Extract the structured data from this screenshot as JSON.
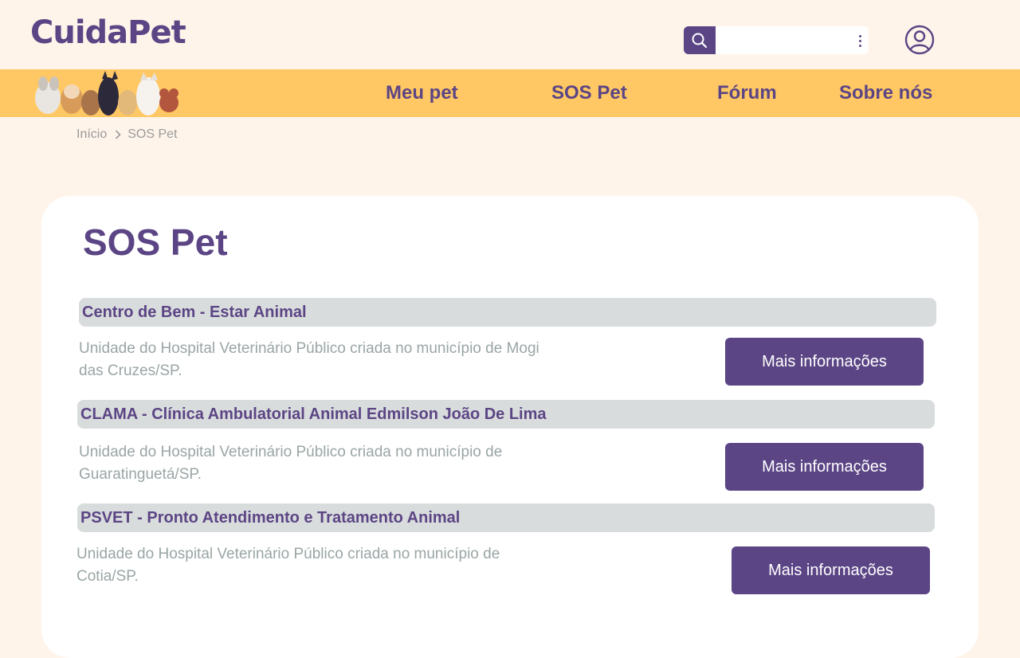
{
  "header": {
    "logo_text": "CuidaPet",
    "search": {
      "placeholder": "",
      "value": ""
    }
  },
  "nav": {
    "items": [
      {
        "label": "Meu pet"
      },
      {
        "label": "SOS Pet"
      },
      {
        "label": "Fórum"
      },
      {
        "label": "Sobre nós"
      }
    ]
  },
  "breadcrumb": {
    "items": [
      {
        "label": "Início"
      },
      {
        "label": "SOS Pet"
      }
    ]
  },
  "main": {
    "title": "SOS Pet",
    "entries": [
      {
        "name": "Centro de Bem - Estar Animal",
        "description": "Unidade do Hospital Veterinário Público criada no município de Mogi das Cruzes/SP.",
        "button_label": "Mais informações"
      },
      {
        "name": "CLAMA - Clínica Ambulatorial Animal Edmilson João De Lima",
        "description": "Unidade do Hospital Veterinário Público criada no município de Guaratinguetá/SP.",
        "button_label": "Mais informações"
      },
      {
        "name": "PSVET - Pronto Atendimento e Tratamento Animal",
        "description": "Unidade do Hospital Veterinário Público criada no município de Cotia/SP.",
        "button_label": "Mais informações"
      }
    ]
  },
  "colors": {
    "page_background": "#fff4ea",
    "brand_purple": "#5b4585",
    "nav_yellow": "#ffc864",
    "card_background": "#ffffff",
    "entry_header_gray": "#d9dcdc",
    "description_gray": "#9aa5a5"
  },
  "icons": [
    "search-icon",
    "more-options-icon",
    "user-profile-icon",
    "chevron-right-icon",
    "pets-illustration"
  ]
}
